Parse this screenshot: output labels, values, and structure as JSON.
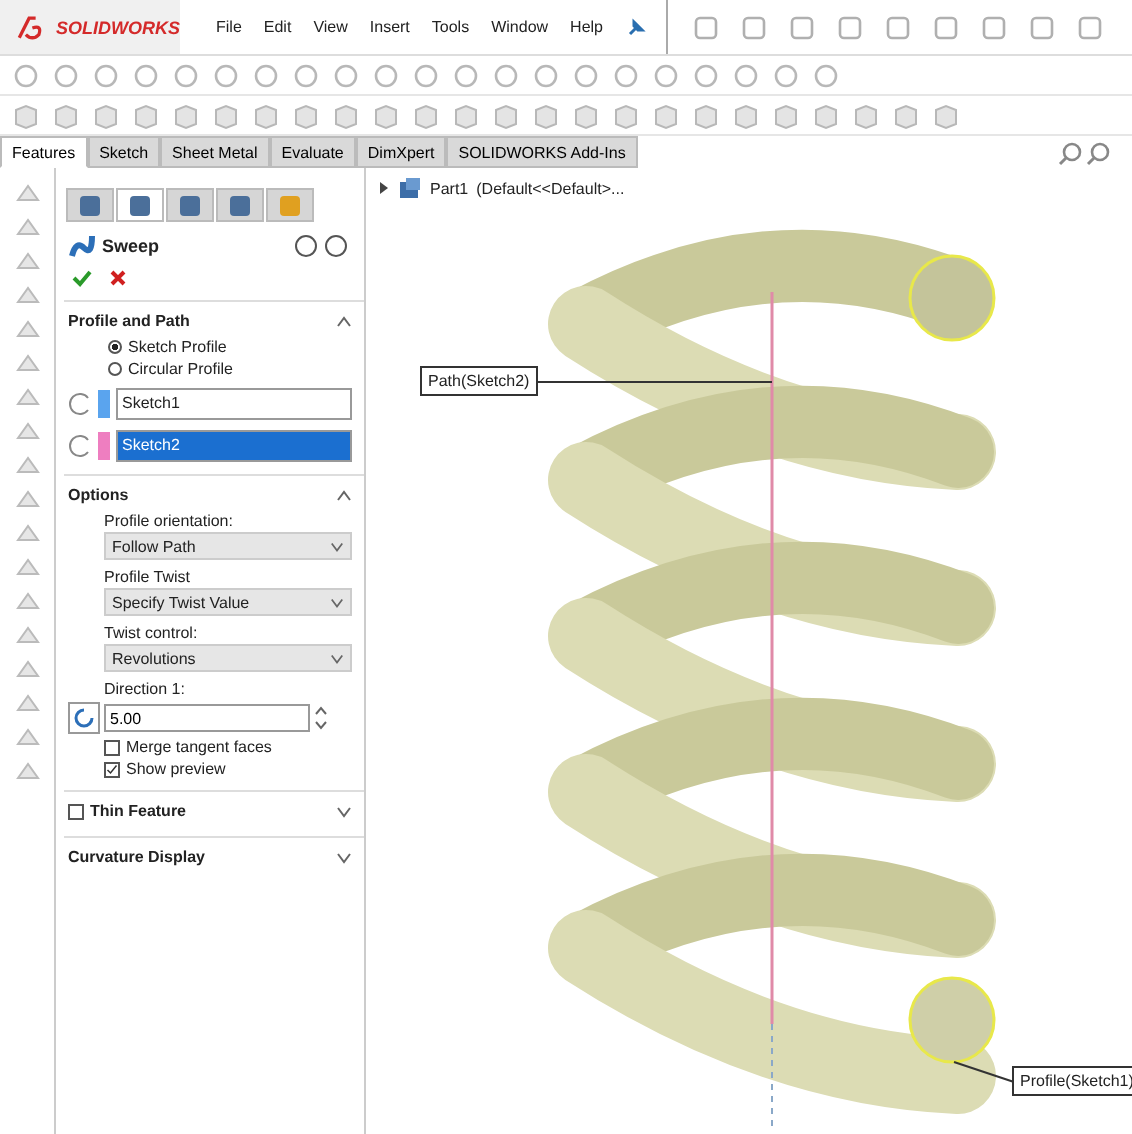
{
  "app": {
    "logo": "SOLIDWORKS"
  },
  "menu": [
    "File",
    "Edit",
    "View",
    "Insert",
    "Tools",
    "Window",
    "Help"
  ],
  "tabs": [
    {
      "label": "Features",
      "selected": true
    },
    {
      "label": "Sketch",
      "selected": false
    },
    {
      "label": "Sheet Metal",
      "selected": false
    },
    {
      "label": "Evaluate",
      "selected": false
    },
    {
      "label": "DimXpert",
      "selected": false
    },
    {
      "label": "SOLIDWORKS Add-Ins",
      "selected": false
    }
  ],
  "tree": {
    "part": "Part1",
    "config": "(Default<<Default>...",
    "expanded": false
  },
  "panel": {
    "tabs": [
      {
        "selected": false
      },
      {
        "selected": true
      },
      {
        "selected": false
      },
      {
        "selected": false
      },
      {
        "selected": false
      }
    ],
    "title": "Sweep",
    "profile_and_path": {
      "title": "Profile and Path",
      "expanded": true,
      "radios": [
        {
          "label": "Sketch Profile",
          "selected": true
        },
        {
          "label": "Circular Profile",
          "selected": false
        }
      ],
      "selections": [
        {
          "value": "Sketch1",
          "color": "#5aa4ee",
          "selected": false
        },
        {
          "value": "Sketch2",
          "color": "#ee7ec0",
          "selected": true
        }
      ]
    },
    "options": {
      "title": "Options",
      "expanded": true,
      "dropdowns": [
        {
          "label": "Profile orientation:",
          "value": "Follow Path"
        },
        {
          "label": "Profile Twist",
          "value": "Specify Twist Value"
        },
        {
          "label": "Twist control:",
          "value": "Revolutions"
        }
      ],
      "direction": {
        "label": "Direction 1:",
        "value": "5.00"
      },
      "checkboxes": [
        {
          "label": "Merge tangent faces",
          "checked": false
        },
        {
          "label": "Show preview",
          "checked": true
        }
      ]
    },
    "thin_feature": {
      "title": "Thin Feature",
      "checked": false,
      "expanded": false
    },
    "curvature": {
      "title": "Curvature Display",
      "expanded": false
    }
  },
  "callouts": [
    {
      "label": "Path(Sketch2)"
    },
    {
      "label": "Profile(Sketch1)"
    }
  ]
}
